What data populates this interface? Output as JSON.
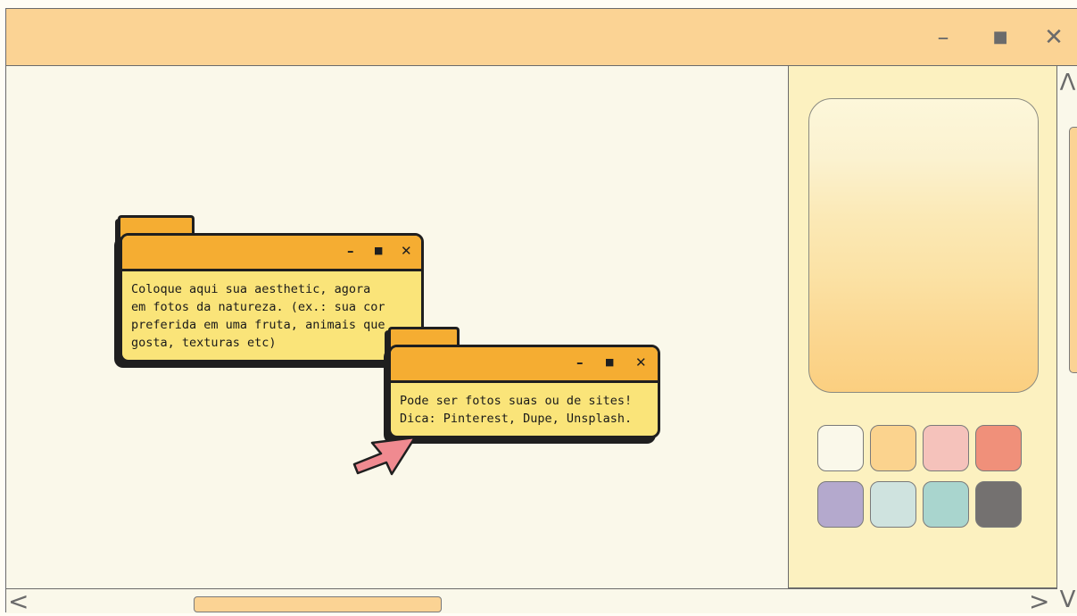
{
  "window": {
    "controls": {
      "minimize": "–",
      "maximize": "■",
      "close": "✕"
    }
  },
  "popup1": {
    "controls": {
      "minimize": "–",
      "maximize": "■",
      "close": "✕"
    },
    "lines": [
      "Coloque aqui sua aesthetic, agora",
      "em fotos da natureza. (ex.: sua cor",
      "preferida em uma fruta, animais que",
      "gosta, texturas etc)"
    ]
  },
  "popup2": {
    "controls": {
      "minimize": "–",
      "maximize": "■",
      "close": "✕"
    },
    "lines": [
      "Pode ser fotos suas ou de sites!",
      "Dica: Pinterest, Dupe, Unsplash."
    ]
  },
  "palette": {
    "swatches": [
      "#faf8ea",
      "#fbd38e",
      "#f5c2bb",
      "#f0907a",
      "#b4a9cd",
      "#cfe3df",
      "#a9d5ce",
      "#747170"
    ]
  },
  "scrollbars": {
    "up_arrow": "Λ",
    "down_arrow": "V",
    "left_arrow": "<",
    "right_arrow": ">"
  },
  "icons": {
    "cursor": "cursor-arrow-icon"
  },
  "colors": {
    "titlebar": "#fbd394",
    "popup_header": "#f5ad32",
    "popup_body": "#fae479",
    "cursor": "#f08a90"
  }
}
